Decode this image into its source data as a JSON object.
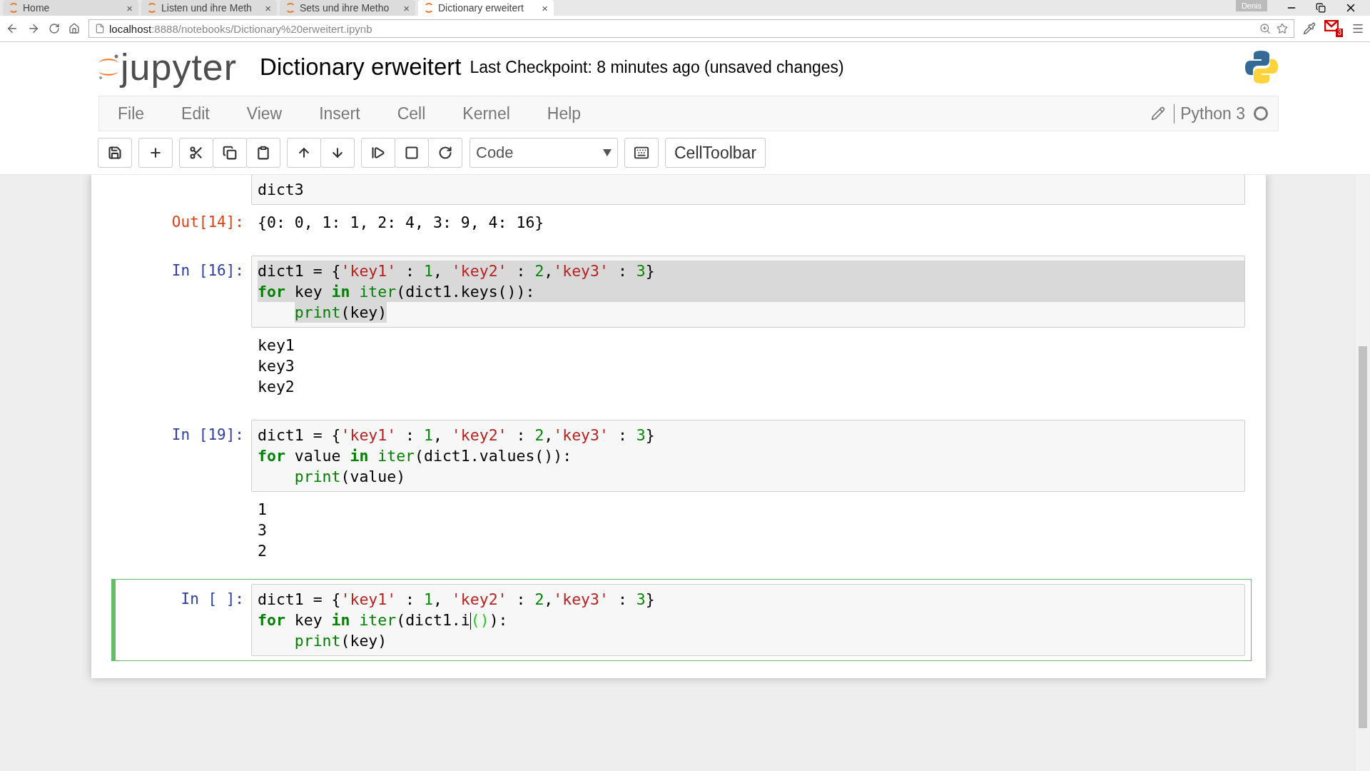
{
  "browser": {
    "tabs": [
      {
        "label": "Home",
        "selected": false
      },
      {
        "label": "Listen und ihre Meth",
        "selected": false
      },
      {
        "label": "Sets und ihre Metho",
        "selected": false
      },
      {
        "label": "Dictionary erweitert",
        "selected": true
      }
    ],
    "close_glyph": "×",
    "profile": "Denis",
    "url": {
      "host": "localhost",
      "path": ":8888/notebooks/Dictionary%20erweitert.ipynb"
    },
    "mail_badge": "3"
  },
  "header": {
    "logo_text": "jupyter",
    "title": "Dictionary erweitert",
    "checkpoint": "Last Checkpoint: 8 minutes ago (unsaved changes)"
  },
  "menu": [
    "File",
    "Edit",
    "View",
    "Insert",
    "Cell",
    "Kernel",
    "Help"
  ],
  "kernel": {
    "name": "Python 3",
    "busy": false
  },
  "toolbar": {
    "cell_type": "Code",
    "celltoolbar": "CellToolbar"
  },
  "cells": [
    {
      "selected": false,
      "areas": [
        {
          "kind": "input",
          "lines": [
            {
              "tokens": [
                {
                  "kind": "plain",
                  "text": "dict3"
                }
              ]
            }
          ]
        },
        {
          "kind": "output",
          "prompt": "Out[14]:",
          "lines": [
            {
              "tokens": [
                {
                  "kind": "plain",
                  "text": "{0: 0, 1: 1, 2: 4, 3: 9, 4: 16}"
                }
              ]
            }
          ]
        }
      ]
    },
    {
      "selected": false,
      "areas": [
        {
          "kind": "input",
          "prompt": "In [16]:",
          "lines": [
            {
              "selected": true,
              "tokens": [
                {
                  "kind": "plain",
                  "text": "dict1 = {"
                },
                {
                  "kind": "string",
                  "text": "'key1'"
                },
                {
                  "kind": "plain",
                  "text": " : "
                },
                {
                  "kind": "number",
                  "text": "1"
                },
                {
                  "kind": "plain",
                  "text": ", "
                },
                {
                  "kind": "string",
                  "text": "'key2'"
                },
                {
                  "kind": "plain",
                  "text": " : "
                },
                {
                  "kind": "number",
                  "text": "2"
                },
                {
                  "kind": "plain",
                  "text": ","
                },
                {
                  "kind": "string",
                  "text": "'key3'"
                },
                {
                  "kind": "plain",
                  "text": " : "
                },
                {
                  "kind": "number",
                  "text": "3"
                },
                {
                  "kind": "plain",
                  "text": "}"
                }
              ]
            },
            {
              "selected": true,
              "tokens": [
                {
                  "kind": "keyword",
                  "text": "for"
                },
                {
                  "kind": "plain",
                  "text": " key "
                },
                {
                  "kind": "keyword",
                  "text": "in"
                },
                {
                  "kind": "builtin",
                  "text": " iter"
                },
                {
                  "kind": "plain",
                  "text": "(dict1.keys()):"
                }
              ]
            },
            {
              "selected": true,
              "indent": true,
              "tokens": [
                {
                  "kind": "builtin",
                  "text": "print"
                },
                {
                  "kind": "plain",
                  "text": "(key)"
                }
              ]
            }
          ]
        },
        {
          "kind": "output",
          "lines": [
            {
              "tokens": [
                {
                  "kind": "plain",
                  "text": "key1"
                }
              ]
            },
            {
              "tokens": [
                {
                  "kind": "plain",
                  "text": "key3"
                }
              ]
            },
            {
              "tokens": [
                {
                  "kind": "plain",
                  "text": "key2"
                }
              ]
            }
          ]
        }
      ]
    },
    {
      "selected": false,
      "areas": [
        {
          "kind": "input",
          "prompt": "In [19]:",
          "lines": [
            {
              "tokens": [
                {
                  "kind": "plain",
                  "text": "dict1 = {"
                },
                {
                  "kind": "string",
                  "text": "'key1'"
                },
                {
                  "kind": "plain",
                  "text": " : "
                },
                {
                  "kind": "number",
                  "text": "1"
                },
                {
                  "kind": "plain",
                  "text": ", "
                },
                {
                  "kind": "string",
                  "text": "'key2'"
                },
                {
                  "kind": "plain",
                  "text": " : "
                },
                {
                  "kind": "number",
                  "text": "2"
                },
                {
                  "kind": "plain",
                  "text": ","
                },
                {
                  "kind": "string",
                  "text": "'key3'"
                },
                {
                  "kind": "plain",
                  "text": " : "
                },
                {
                  "kind": "number",
                  "text": "3"
                },
                {
                  "kind": "plain",
                  "text": "}"
                }
              ]
            },
            {
              "tokens": [
                {
                  "kind": "keyword",
                  "text": "for"
                },
                {
                  "kind": "plain",
                  "text": " value "
                },
                {
                  "kind": "keyword",
                  "text": "in"
                },
                {
                  "kind": "builtin",
                  "text": " iter"
                },
                {
                  "kind": "plain",
                  "text": "(dict1.values()):"
                }
              ]
            },
            {
              "indent": true,
              "tokens": [
                {
                  "kind": "builtin",
                  "text": "print"
                },
                {
                  "kind": "plain",
                  "text": "(value)"
                }
              ]
            }
          ]
        },
        {
          "kind": "output",
          "lines": [
            {
              "tokens": [
                {
                  "kind": "plain",
                  "text": "1"
                }
              ]
            },
            {
              "tokens": [
                {
                  "kind": "plain",
                  "text": "3"
                }
              ]
            },
            {
              "tokens": [
                {
                  "kind": "plain",
                  "text": "2"
                }
              ]
            }
          ]
        }
      ]
    },
    {
      "selected": true,
      "areas": [
        {
          "kind": "input",
          "prompt": "In [ ]:",
          "lines": [
            {
              "tokens": [
                {
                  "kind": "plain",
                  "text": "dict1 = {"
                },
                {
                  "kind": "string",
                  "text": "'key1'"
                },
                {
                  "kind": "plain",
                  "text": " : "
                },
                {
                  "kind": "number",
                  "text": "1"
                },
                {
                  "kind": "plain",
                  "text": ", "
                },
                {
                  "kind": "string",
                  "text": "'key2'"
                },
                {
                  "kind": "plain",
                  "text": " : "
                },
                {
                  "kind": "number",
                  "text": "2"
                },
                {
                  "kind": "plain",
                  "text": ","
                },
                {
                  "kind": "string",
                  "text": "'key3'"
                },
                {
                  "kind": "plain",
                  "text": " : "
                },
                {
                  "kind": "number",
                  "text": "3"
                },
                {
                  "kind": "plain",
                  "text": "}"
                }
              ]
            },
            {
              "tokens": [
                {
                  "kind": "keyword",
                  "text": "for"
                },
                {
                  "kind": "plain",
                  "text": " key "
                },
                {
                  "kind": "keyword",
                  "text": "in"
                },
                {
                  "kind": "builtin",
                  "text": " iter"
                },
                {
                  "kind": "plain",
                  "text": "(dict1.i"
                },
                {
                  "kind": "caret"
                },
                {
                  "kind": "match",
                  "text": "()"
                },
                {
                  "kind": "plain",
                  "text": "):"
                }
              ]
            },
            {
              "indent": true,
              "tokens": [
                {
                  "kind": "builtin",
                  "text": "print"
                },
                {
                  "kind": "plain",
                  "text": "(key)"
                }
              ]
            }
          ]
        }
      ]
    }
  ]
}
